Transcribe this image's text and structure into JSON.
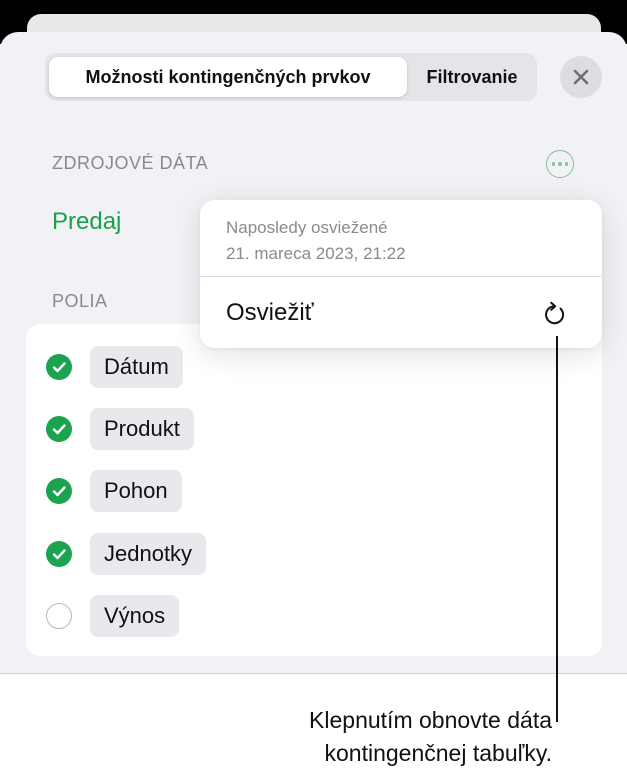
{
  "tabs": [
    {
      "label": "Možnosti kontingenčných prvkov",
      "active": true
    },
    {
      "label": "Filtrovanie",
      "active": false
    }
  ],
  "source": {
    "heading": "ZDROJOVÉ DÁTA",
    "name": "Predaj"
  },
  "fields": {
    "heading": "POLIA",
    "items": [
      {
        "label": "Dátum",
        "checked": true
      },
      {
        "label": "Produkt",
        "checked": true
      },
      {
        "label": "Pohon",
        "checked": true
      },
      {
        "label": "Jednotky",
        "checked": true
      },
      {
        "label": "Výnos",
        "checked": false
      }
    ]
  },
  "popover": {
    "caption_line1": "Naposledy osviežené",
    "caption_line2": "21. mareca 2023, 21:22",
    "action_label": "Osviežiť"
  },
  "callout": {
    "line1": "Klepnutím obnovte dáta",
    "line2": "kontingenčnej tabuľky."
  },
  "colors": {
    "accent": "#19a14a",
    "check": "#1ba34e"
  },
  "icons": {
    "close": "close-icon",
    "more": "more-icon",
    "refresh": "refresh-icon",
    "checkmark": "checkmark-icon"
  }
}
